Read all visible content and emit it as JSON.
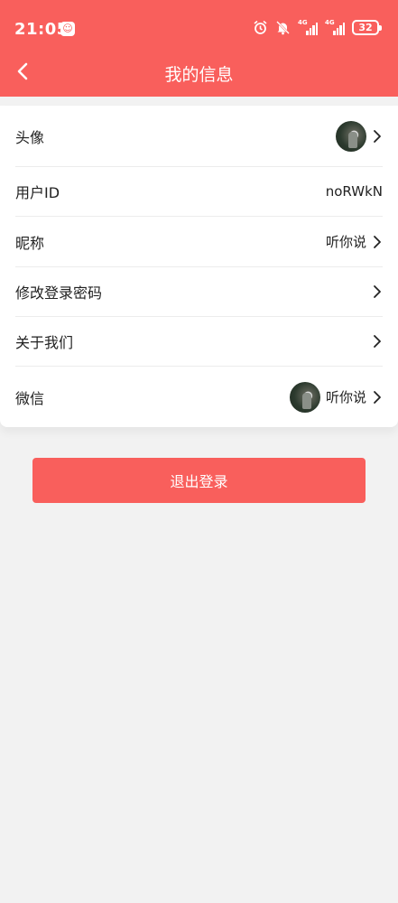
{
  "status": {
    "time": "21:05",
    "signal_1_label": "4G",
    "signal_2_label": "4G",
    "battery": "32",
    "icons": [
      "app-notification-icon",
      "alarm-icon",
      "mute-icon",
      "signal-icon",
      "signal-icon",
      "battery-icon"
    ]
  },
  "header": {
    "title": "我的信息",
    "back_icon": "chevron-left-icon",
    "color": "#f95f5c"
  },
  "rows": {
    "avatar": {
      "label": "头像"
    },
    "user_id": {
      "label": "用户ID",
      "value": "noRWkN"
    },
    "nickname": {
      "label": "昵称",
      "value": "听你说"
    },
    "password": {
      "label": "修改登录密码"
    },
    "about": {
      "label": "关于我们"
    },
    "wechat": {
      "label": "微信",
      "value": "听你说"
    }
  },
  "logout_button": {
    "label": "退出登录"
  }
}
